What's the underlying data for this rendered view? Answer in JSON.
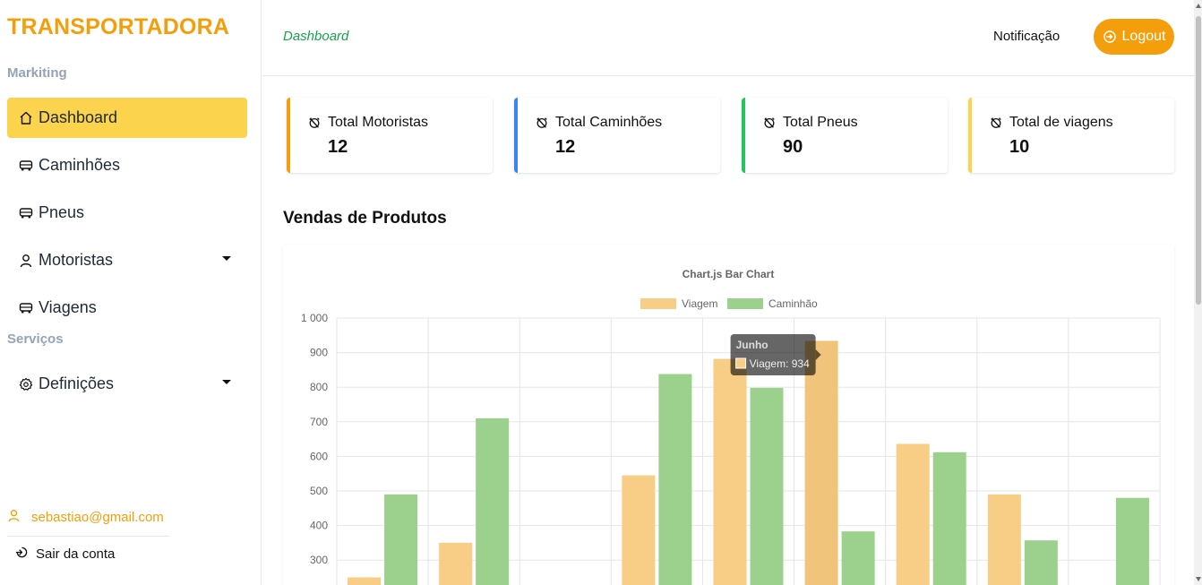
{
  "sidebar": {
    "brand": "TRANSPORTADORA",
    "section_marketing": "Markiting",
    "section_services": "Serviços",
    "items": [
      {
        "label": "Dashboard",
        "icon": "home-icon",
        "active": true
      },
      {
        "label": "Caminhões",
        "icon": "truck-icon"
      },
      {
        "label": "Pneus",
        "icon": "truck-icon"
      },
      {
        "label": "Motoristas",
        "icon": "user-icon",
        "has_dropdown": true
      },
      {
        "label": "Viagens",
        "icon": "truck-icon"
      },
      {
        "label": "Definições",
        "icon": "gear-icon",
        "has_dropdown": true
      }
    ],
    "user_email": "sebastiao@gmail.com",
    "logout_label": "Sair da conta"
  },
  "topbar": {
    "breadcrumb": "Dashboard",
    "notification": "Notificação",
    "logout_button": "Logout"
  },
  "stats": [
    {
      "label": "Total Motoristas",
      "value": "12",
      "color": "#f59e0b"
    },
    {
      "label": "Total Caminhões",
      "value": "12",
      "color": "#3b82f6"
    },
    {
      "label": "Total Pneus",
      "value": "90",
      "color": "#22c55e"
    },
    {
      "label": "Total de viagens",
      "value": "10",
      "color": "#fcd34d"
    }
  ],
  "section_title": "Vendas de Produtos",
  "chart_data": {
    "type": "bar",
    "title": "Chart.js Bar Chart",
    "xlabel": "",
    "ylabel": "",
    "ylim": [
      200,
      1000
    ],
    "y_ticks": [
      "1 000",
      "900",
      "800",
      "700",
      "600",
      "500",
      "400",
      "300"
    ],
    "grid": true,
    "legend_position": "top",
    "categories": [
      "",
      "",
      "",
      "",
      "",
      "Junho",
      "",
      "",
      ""
    ],
    "series": [
      {
        "name": "Viagem",
        "color": "#f8cd86",
        "values": [
          250,
          350,
          0,
          545,
          882,
          934,
          636,
          490,
          0
        ]
      },
      {
        "name": "Caminhão",
        "color": "#9bd18c",
        "values": [
          490,
          710,
          0,
          838,
          798,
          383,
          612,
          357,
          480
        ]
      }
    ],
    "tooltip": {
      "title": "Junho",
      "label": "Viagem: 934",
      "category_index": 5
    }
  }
}
